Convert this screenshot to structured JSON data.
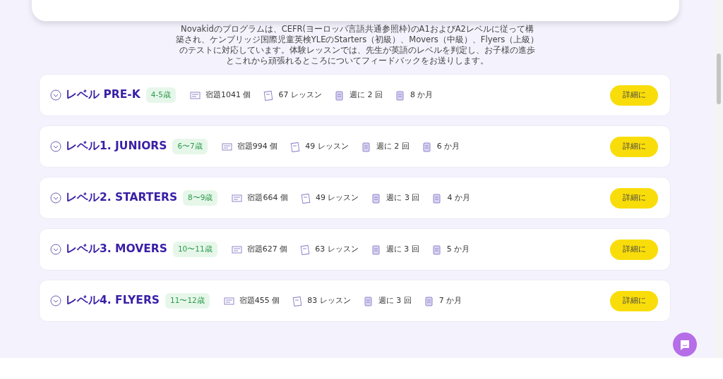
{
  "intro": {
    "lines": [
      "Novakidのプログラムは、CEFR(ヨーロッパ言語共通参照枠)のA1およびA2レベルに従って構",
      "築され、ケンブリッジ国際児童英検YLEのStarters（初級）、Movers（中級）、Flyers（上級）",
      "のテストに対応しています。体験レッスンでは、先生が英語のレベルを判定し、お子様の進歩",
      "とこれから頑張れるところについてフィードバックをお送りします。"
    ]
  },
  "levels": [
    {
      "title": "レベル PRE-K",
      "age": "4-5歳",
      "homework": "宿題1041 個",
      "lessons": "67 レッスン",
      "frequency": "週に 2 回",
      "duration": "8 か月",
      "button": "詳細に",
      "expanded": false
    },
    {
      "title": "レベル1. JUNIORS",
      "age": "6〜7歳",
      "homework": "宿題994 個",
      "lessons": "49 レッスン",
      "frequency": "週に 2 回",
      "duration": "6 か月",
      "button": "詳細に",
      "expanded": false
    },
    {
      "title": "レベル2. STARTERS",
      "age": "8〜9歳",
      "homework": "宿題664 個",
      "lessons": "49 レッスン",
      "frequency": "週に 3 回",
      "duration": "4 か月",
      "button": "詳細に",
      "expanded": false
    },
    {
      "title": "レベル3. MOVERS",
      "age": "10〜11歳",
      "homework": "宿題627 個",
      "lessons": "63 レッスン",
      "frequency": "週に 3 回",
      "duration": "5 か月",
      "button": "詳細に",
      "expanded": false
    },
    {
      "title": "レベル4. FLYERS",
      "age": "11〜12歳",
      "homework": "宿題455 個",
      "lessons": "83 レッスン",
      "frequency": "週に 3 回",
      "duration": "7 か月",
      "button": "詳細に",
      "expanded": false
    }
  ]
}
